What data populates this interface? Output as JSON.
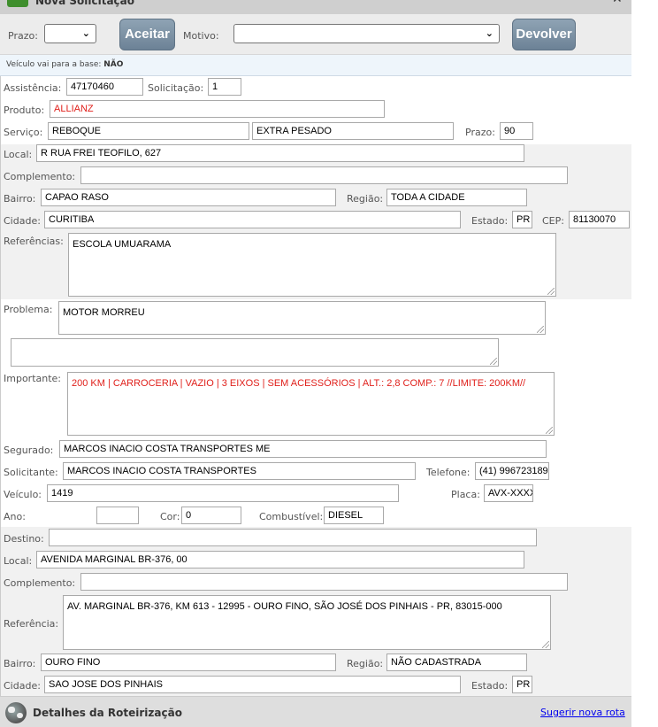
{
  "window": {
    "title": "Nova Solicitação"
  },
  "toolbar": {
    "prazo_label": "Prazo:",
    "prazo_value": "",
    "accept_label": "Aceitar",
    "motivo_label": "Motivo:",
    "motivo_value": "",
    "return_label": "Devolver"
  },
  "info": {
    "base_label": "Veículo vai para a base:",
    "base_value": "NÃO"
  },
  "form": {
    "assistencia_label": "Assistência:",
    "assistencia": "47170460",
    "solicitacao_label": "Solicitação:",
    "solicitacao": "1",
    "produto_label": "Produto:",
    "produto": "ALLIANZ",
    "servico_label": "Serviço:",
    "servico": "REBOQUE",
    "servico_tipo": "EXTRA PESADO",
    "prazo_label": "Prazo:",
    "prazo": "90",
    "local_label": "Local:",
    "local": "R RUA FREI TEOFILO, 627",
    "complemento_label": "Complemento:",
    "complemento": "",
    "bairro_label": "Bairro:",
    "bairro": "CAPAO RASO",
    "regiao_label": "Região:",
    "regiao": "TODA A CIDADE",
    "cidade_label": "Cidade:",
    "cidade": "CURITIBA",
    "estado_label": "Estado:",
    "estado": "PR",
    "cep_label": "CEP:",
    "cep": "81130070",
    "referencias_label": "Referências:",
    "referencias": "ESCOLA UMUARAMA",
    "problema_label": "Problema:",
    "problema": "MOTOR MORREU",
    "problema_extra": "",
    "importante_label": "Importante:",
    "importante": "200 KM | CARROCERIA | VAZIO | 3 EIXOS | SEM ACESSÓRIOS | ALT.: 2,8 COMP.: 7 //LIMITE: 200KM//",
    "segurado_label": "Segurado:",
    "segurado": "MARCOS INACIO COSTA TRANSPORTES ME",
    "solicitante_label": "Solicitante:",
    "solicitante": "MARCOS INACIO COSTA TRANSPORTES",
    "telefone_label": "Telefone:",
    "telefone": "(41) 996723189",
    "veiculo_label": "Veículo:",
    "veiculo": "1419",
    "placa_label": "Placa:",
    "placa": "AVX-XXXX",
    "ano_label": "Ano:",
    "ano": "",
    "cor_label": "Cor:",
    "cor": "0",
    "combustivel_label": "Combustível:",
    "combustivel": "DIESEL"
  },
  "destino": {
    "destino_label": "Destino:",
    "destino": "",
    "local_label": "Local:",
    "local": "AVENIDA MARGINAL BR-376, 00",
    "complemento_label": "Complemento:",
    "complemento": "",
    "referencia_label": "Referência:",
    "referencia": "AV. MARGINAL BR-376, KM 613 - 12995 - OURO FINO, SÃO JOSÉ DOS PINHAIS - PR, 83015-000",
    "bairro_label": "Bairro:",
    "bairro": "OURO FINO",
    "regiao_label": "Região:",
    "regiao": "NÃO CADASTRADA",
    "cidade_label": "Cidade:",
    "cidade": "SAO JOSE DOS PINHAIS",
    "estado_label": "Estado:",
    "estado": "PR"
  },
  "footer": {
    "title": "Detalhes da Roteirização",
    "link": "Sugerir nova rota"
  }
}
